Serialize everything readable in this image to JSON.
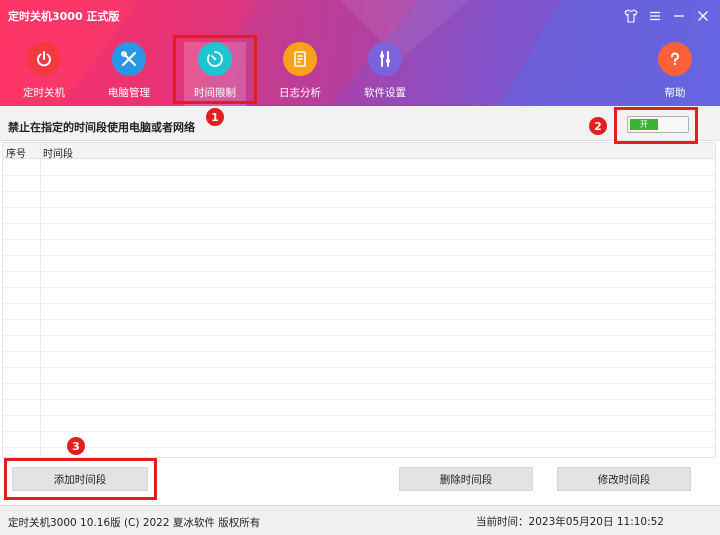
{
  "window": {
    "title": "定时关机3000 正式版"
  },
  "nav": {
    "items": [
      {
        "label": "定时关机",
        "icon": "power-icon",
        "color": "#f4383f"
      },
      {
        "label": "电脑管理",
        "icon": "tools-icon",
        "color": "#2a97e6"
      },
      {
        "label": "时间限制",
        "icon": "timer-icon",
        "color": "#1ec4d2"
      },
      {
        "label": "日志分析",
        "icon": "log-icon",
        "color": "#f7a21a"
      },
      {
        "label": "软件设置",
        "icon": "settings-icon",
        "color": "#7b62de"
      }
    ],
    "help": {
      "label": "帮助",
      "icon": "help-icon",
      "color": "#fa6138"
    },
    "active_index": 2
  },
  "setting": {
    "label": "禁止在指定的时间段使用电脑或者网络",
    "toggle_text": "开",
    "toggle_on": true
  },
  "table": {
    "columns": [
      "序号",
      "时间段"
    ],
    "rows": []
  },
  "buttons": {
    "add": "添加时间段",
    "delete": "删除时间段",
    "edit": "修改时间段"
  },
  "annotations": {
    "one": "1",
    "two": "2",
    "three": "3"
  },
  "footer": {
    "copyright": "定时关机3000 10.16版 (C) 2022  夏冰软件 版权所有",
    "time": "当前时间：2023年05月20日 11:10:52"
  },
  "colors": {
    "annotation_red": "#e41e1e",
    "toggle_green": "#3bb233"
  }
}
